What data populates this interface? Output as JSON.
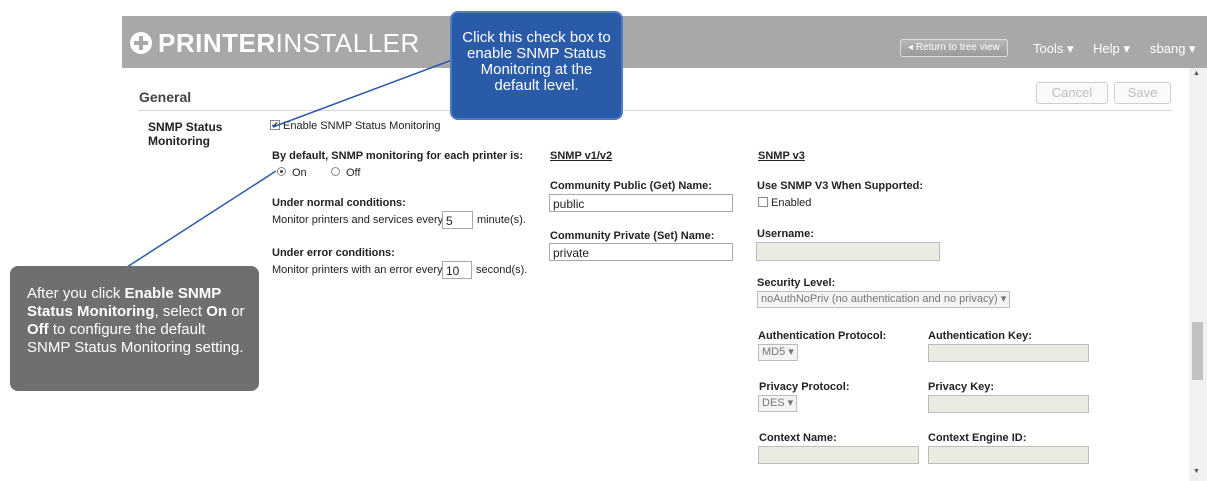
{
  "header": {
    "logo_bold": "PRINTER",
    "logo_light": "INSTALLER",
    "back_button": "Return to tree view",
    "tools": "Tools ▾",
    "help": "Help ▾",
    "user": "sbang ▾"
  },
  "section": {
    "title": "General",
    "cancel": "Cancel",
    "save": "Save"
  },
  "snmp": {
    "label": "SNMP Status Monitoring",
    "enable_label": "Enable SNMP Status Monitoring",
    "enable_checked": true,
    "default_label": "By default, SNMP monitoring for each printer is:",
    "on_label": "On",
    "off_label": "Off",
    "default_selected": "On",
    "normal_heading": "Under normal conditions:",
    "normal_text": "Monitor printers and services every",
    "normal_value": "5",
    "normal_unit": "minute(s).",
    "error_heading": "Under error conditions:",
    "error_text": "Monitor printers with an error every",
    "error_value": "10",
    "error_unit": "second(s)."
  },
  "v1v2": {
    "heading": "SNMP v1/v2",
    "public_label": "Community Public (Get) Name:",
    "public_value": "public",
    "private_label": "Community Private (Set) Name:",
    "private_value": "private"
  },
  "v3": {
    "heading": "SNMP v3",
    "use_label": "Use SNMP V3 When Supported:",
    "enabled_label": "Enabled",
    "enabled_checked": false,
    "username_label": "Username:",
    "username_value": "",
    "security_label": "Security Level:",
    "security_value": "noAuthNoPriv (no authentication and no privacy) ▾",
    "auth_protocol_label": "Authentication Protocol:",
    "auth_protocol_value": "MD5 ▾",
    "auth_key_label": "Authentication Key:",
    "privacy_protocol_label": "Privacy Protocol:",
    "privacy_protocol_value": "DES ▾",
    "privacy_key_label": "Privacy Key:",
    "context_name_label": "Context Name:",
    "context_engine_label": "Context Engine ID:"
  },
  "callouts": {
    "checkbox_tip": "Click this check box to enable SNMP Status Monitoring at the default level.",
    "gray_t1": "After you click ",
    "gray_b1": "Enable SNMP Status Monitoring",
    "gray_t2": ", select ",
    "gray_b2": "On",
    "gray_t3": " or ",
    "gray_b3": "Off",
    "gray_t4": " to configure the default SNMP Status Monitoring setting."
  },
  "colors": {
    "header_bg": "#a8a8a8",
    "callout_blue": "#2a5ba8",
    "callout_gray": "#6f6f6f"
  }
}
